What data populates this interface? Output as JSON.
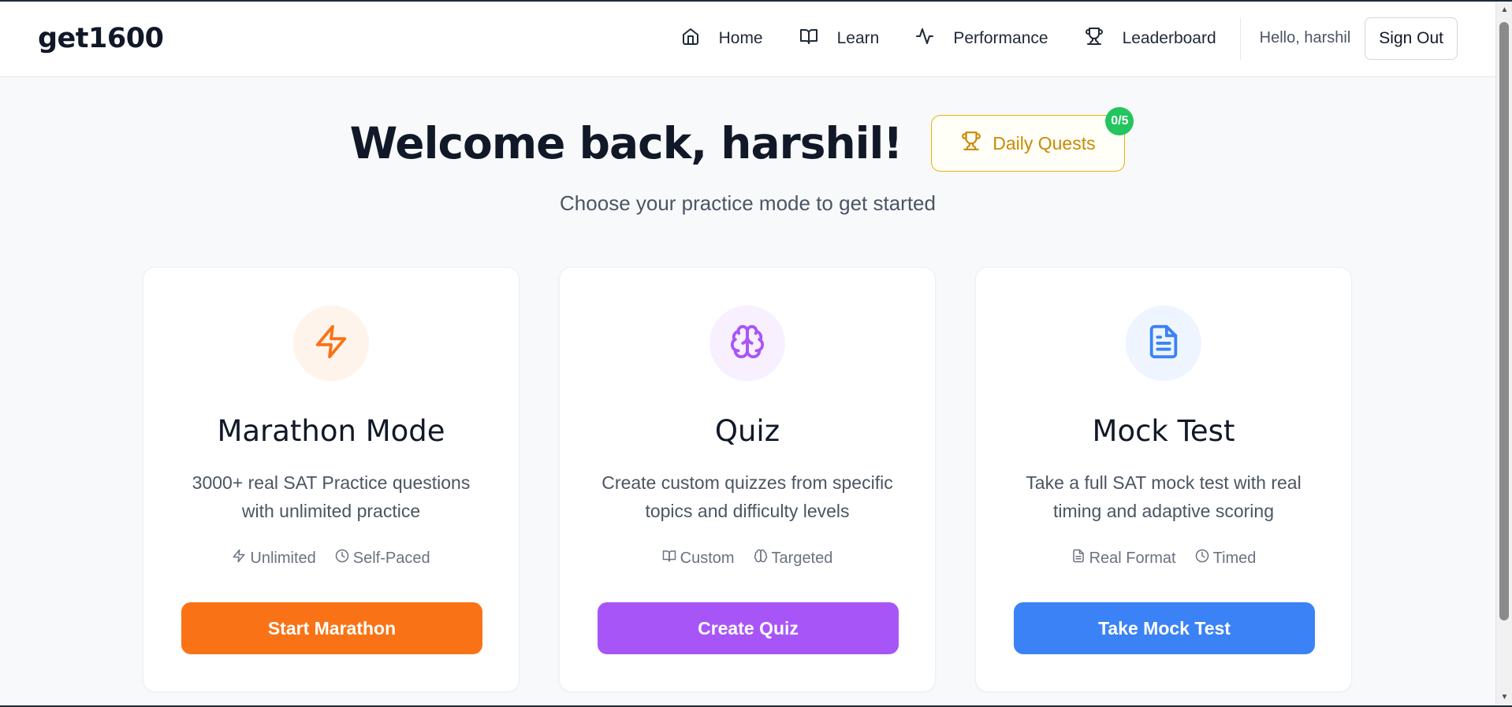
{
  "header": {
    "logo": "get1600",
    "nav": [
      {
        "label": "Home",
        "icon": "home-icon"
      },
      {
        "label": "Learn",
        "icon": "book-open-icon"
      },
      {
        "label": "Performance",
        "icon": "activity-icon"
      },
      {
        "label": "Leaderboard",
        "icon": "trophy-icon"
      }
    ],
    "greeting": "Hello, harshil",
    "signout_label": "Sign Out"
  },
  "hero": {
    "title": "Welcome back, harshil!",
    "subtitle": "Choose your practice mode to get started",
    "quests_label": "Daily Quests",
    "quests_badge": "0/5",
    "quests_color": "#ca8a04",
    "badge_color": "#22c55e"
  },
  "cards": [
    {
      "title": "Marathon Mode",
      "description": "3000+ real SAT Practice questions with unlimited practice",
      "tags": [
        {
          "label": "Unlimited",
          "icon": "zap-icon"
        },
        {
          "label": "Self-Paced",
          "icon": "clock-icon"
        }
      ],
      "button_label": "Start Marathon",
      "icon": "zap-icon",
      "accent": "#f97316",
      "icon_bg": "#fff4eb"
    },
    {
      "title": "Quiz",
      "description": "Create custom quizzes from specific topics and difficulty levels",
      "tags": [
        {
          "label": "Custom",
          "icon": "book-open-icon"
        },
        {
          "label": "Targeted",
          "icon": "brain-icon"
        }
      ],
      "button_label": "Create Quiz",
      "icon": "brain-icon",
      "accent": "#a855f7",
      "icon_bg": "#f8f0ff"
    },
    {
      "title": "Mock Test",
      "description": "Take a full SAT mock test with real timing and adaptive scoring",
      "tags": [
        {
          "label": "Real Format",
          "icon": "file-text-icon"
        },
        {
          "label": "Timed",
          "icon": "clock-icon"
        }
      ],
      "button_label": "Take Mock Test",
      "icon": "file-text-icon",
      "accent": "#3b82f6",
      "icon_bg": "#eef5ff"
    }
  ]
}
